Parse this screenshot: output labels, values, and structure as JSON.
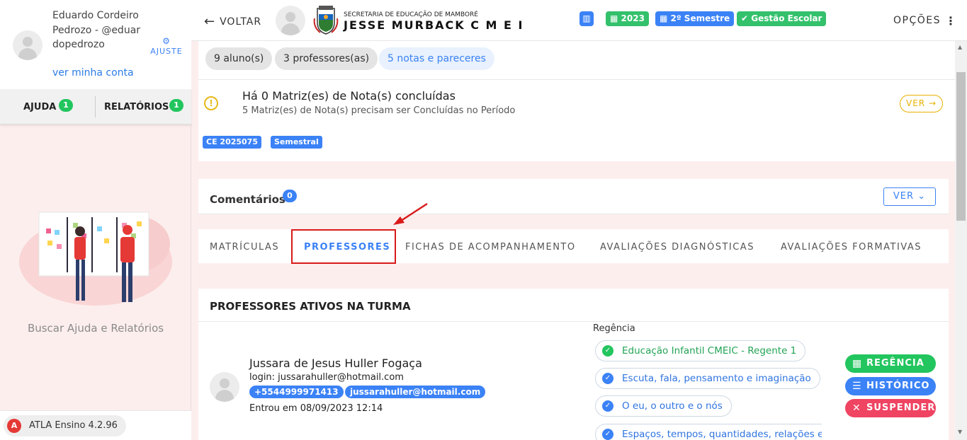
{
  "user": {
    "name": "Eduardo Cordeiro Pedrozo - @eduardopedrozo",
    "account_link": "ver minha conta",
    "settings_label": "AJUSTE"
  },
  "help_tabs": [
    {
      "label": "AJUDA",
      "count": "1"
    },
    {
      "label": "RELATÓRIOS",
      "count": "1"
    }
  ],
  "help_caption": "Buscar Ajuda e Relatórios",
  "version": "ATLA Ensino 4.2.96",
  "topbar": {
    "back_label": "VOLTAR",
    "school_subtitle": "SECRETARIA DE EDUCAÇÃO DE MAMBORÉ",
    "school_name": "JESSE MURBACK C M E I",
    "chips": [
      "2023",
      "2º Semestre",
      "Gestão Escolar"
    ],
    "options_label": "OPÇÕES"
  },
  "summary": {
    "pills": [
      "9 aluno(s)",
      "3 professores(as)",
      "5 notas e pareceres"
    ],
    "matrix_title": "Há 0 Matriz(es) de Nota(s) concluídas",
    "matrix_subtitle": "5 Matriz(es) de Nota(s) precisam ser Concluídas no Período",
    "ver_label": "VER",
    "tags": [
      "CE 2025075",
      "Semestral"
    ]
  },
  "comments": {
    "title": "Comentários",
    "count": "0",
    "ver_label": "VER"
  },
  "tabs": [
    "MATRÍCULAS",
    "PROFESSORES",
    "FICHAS DE ACOMPANHAMENTO",
    "AVALIAÇÕES DIAGNÓSTICAS",
    "AVALIAÇÕES FORMATIVAS"
  ],
  "active_tab": "PROFESSORES",
  "professors": {
    "heading": "PROFESSORES ATIVOS NA TURMA",
    "items": [
      {
        "name": "Jussara de Jesus Huller Fogaça",
        "login": "login: jussarahuller@hotmail.com",
        "phone": "+5544999971413",
        "email": "jussarahuller@hotmail.com",
        "entered": "Entrou em 08/09/2023 12:14",
        "regencia_label": "Regência",
        "regencias": [
          "Educação Infantil CMEIC - Regente 1",
          "Escuta, fala, pensamento e imaginação",
          "O eu, o outro e o nós",
          "Espaços, tempos, quantidades, relações e transformações"
        ],
        "actions": [
          "REGÊNCIA",
          "HISTÓRICO",
          "SUSPENDER"
        ]
      }
    ]
  },
  "colors": {
    "accent_blue": "#3b82f6",
    "success_green": "#22c55e",
    "danger_red": "#ef4462",
    "warning_yellow": "#e8b100",
    "background_pink": "#fdeeee",
    "highlight_red": "#d91a1a"
  },
  "icons": [
    "user-avatar-icon",
    "gear-icon",
    "back-arrow-icon",
    "school-avatar-icon",
    "crest-icon",
    "chart-icon",
    "calendar-icon",
    "check-circle-icon",
    "kebab-menu-icon",
    "warning-icon",
    "arrow-right-icon",
    "chevron-down-icon",
    "check-icon",
    "calendar-grid-icon",
    "list-icon",
    "close-icon",
    "atla-logo-icon"
  ]
}
